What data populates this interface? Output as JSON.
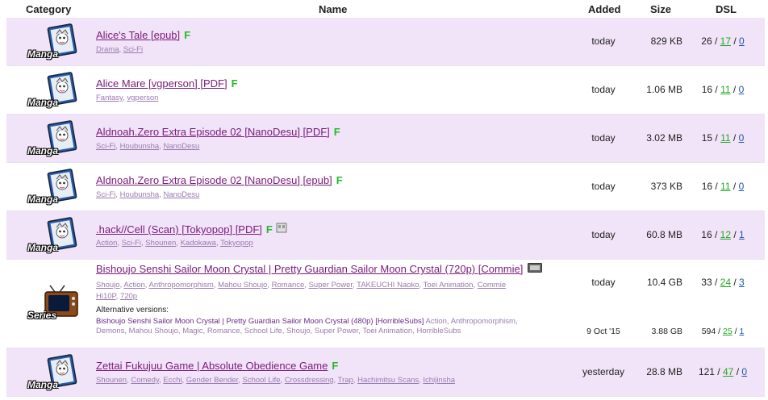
{
  "header": {
    "category": "Category",
    "name": "Name",
    "added": "Added",
    "size": "Size",
    "dsl": "DSL"
  },
  "rows": [
    {
      "category": "Manga",
      "title": "Alice's Tale [epub]",
      "flags": [
        "F"
      ],
      "tags": [
        "Drama",
        "Sci-Fi"
      ],
      "added": "today",
      "size": "829 KB",
      "seeds": "26",
      "leech": "17",
      "done": "0"
    },
    {
      "category": "Manga",
      "title": "Alice Mare [vgperson] [PDF]",
      "flags": [
        "F"
      ],
      "tags": [
        "Fantasy",
        "vgperson"
      ],
      "added": "today",
      "size": "1.06 MB",
      "seeds": "16",
      "leech": "11",
      "done": "0"
    },
    {
      "category": "Manga",
      "title": "Aldnoah.Zero Extra Episode 02 [NanoDesu] [PDF]",
      "flags": [
        "F"
      ],
      "tags": [
        "Sci-Fi",
        "Houbunsha",
        "NanoDesu"
      ],
      "added": "today",
      "size": "3.02 MB",
      "seeds": "15",
      "leech": "11",
      "done": "0"
    },
    {
      "category": "Manga",
      "title": "Aldnoah.Zero Extra Episode 02 [NanoDesu] [epub]",
      "flags": [
        "F"
      ],
      "tags": [
        "Sci-Fi",
        "Houbunsha",
        "NanoDesu"
      ],
      "added": "today",
      "size": "373 KB",
      "seeds": "16",
      "leech": "11",
      "done": "0"
    },
    {
      "category": "Manga",
      "title": ".hack//Cell (Scan) [Tokyopop] [PDF]",
      "flags": [
        "F"
      ],
      "tags": [
        "Action",
        "Sci-Fi",
        "Shounen",
        "Kadokawa",
        "Tokyopop"
      ],
      "added": "today",
      "size": "60.8 MB",
      "seeds": "16",
      "leech": "12",
      "done": "1"
    },
    {
      "category": "Series",
      "title": "Bishoujo Senshi Sailor Moon Crystal | Pretty Guardian Sailor Moon Crystal (720p) [Commie]",
      "tags_line1": [
        "Shoujo",
        "Action",
        "Anthropomorphism",
        "Mahou Shoujo",
        "Romance",
        "Super Power",
        "TAKEUCHI Naoko",
        "Toei Animation",
        "Commie"
      ],
      "tags_line2": [
        "Hi10P",
        "720p"
      ],
      "added": "today",
      "size": "10.4 GB",
      "seeds": "33",
      "leech": "24",
      "done": "3",
      "alternative": {
        "heading": "Alternative versions:",
        "title": "Bishoujo Senshi Sailor Moon Crystal | Pretty Guardian Sailor Moon Crystal (480p) [HorribleSubs]",
        "tags": "Action, Anthropomorphism, Demons, Mahou Shoujo, Magic, Romance, School Life, Shoujo, Super Power, Toei Animation, HorribleSubs",
        "added": "9 Oct '15",
        "size": "3.88 GB",
        "seeds": "594",
        "leech": "25",
        "done": "1"
      }
    },
    {
      "category": "Manga",
      "title": "Zettai Fukujuu Game | Absolute Obedience Game",
      "flags": [
        "F"
      ],
      "tags": [
        "Shounen",
        "Comedy",
        "Ecchi",
        "Gender Bender",
        "School Life",
        "Crossdressing",
        "Trap",
        "Hachimitsu Scans",
        "Ichijinsha"
      ],
      "added": "yesterday",
      "size": "28.8 MB",
      "seeds": "121",
      "leech": "47",
      "done": "0"
    }
  ],
  "separator": "/",
  "tag_separator": ",",
  "colors": {
    "row_odd": "#f1e4f8",
    "row_even": "#ffffff",
    "link": "#7a1a7a",
    "flag": "#22bb22",
    "leech": "#22aa22",
    "done": "#2255aa"
  },
  "icons": {
    "manga": "manga-book-icon",
    "series": "tv-icon",
    "hd": "hd-badge-icon",
    "scan": "scan-icon"
  }
}
